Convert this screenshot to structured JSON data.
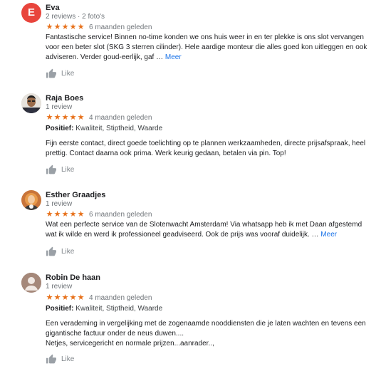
{
  "colors": {
    "star": "#e7711b",
    "link": "#1a73e8",
    "avatar_eva": "#e8453c"
  },
  "reviews": [
    {
      "name": "Eva",
      "meta": "2 reviews · 2 foto's",
      "avatar_letter": "E",
      "stars": 5,
      "date": "6 maanden geleden",
      "text": "Fantastische service! Binnen no-time konden we ons huis weer in en ter plekke is ons slot vervangen voor een beter slot (SKG 3 sterren cilinder). Hele aardige monteur die alles goed kon uitleggen en ook adviseren. Verder goud-eerlijk, gaf …",
      "more": "Meer",
      "like": "Like"
    },
    {
      "name": "Raja Boes",
      "meta": "1 review",
      "avatar_icon": "person-photo-icon",
      "stars": 5,
      "date": "4 maanden geleden",
      "positive_label": "Positief:",
      "positive_value": "Kwaliteit, Stiptheid, Waarde",
      "text": "Fijn eerste contact, direct goede toelichting op te plannen werkzaamheden, directe prijsafspraak, heel prettig. Contact daarna ook prima. Werk keurig gedaan, betalen via pin. Top!",
      "like": "Like"
    },
    {
      "name": "Esther Graadjes",
      "meta": "1 review",
      "avatar_icon": "person-photo-icon",
      "stars": 5,
      "date": "6 maanden geleden",
      "text": "Wat een perfecte service van de Slotenwacht Amsterdam! Via whatsapp heb ik met Daan afgestemd wat ik wilde en werd ik professioneel geadviseerd. Ook de prijs was vooraf duidelijk. …",
      "more": "Meer",
      "like": "Like"
    },
    {
      "name": "Robin De haan",
      "meta": "1 review",
      "avatar_icon": "default-avatar-icon",
      "stars": 5,
      "date": "4 maanden geleden",
      "positive_label": "Positief:",
      "positive_value": "Kwaliteit, Stiptheid, Waarde",
      "text": "Een verademing in vergelijking met de zogenaamde nooddiensten die je laten wachten en tevens een gigantische factuur onder de neus duwen....",
      "text_line2": "Netjes, servicegericht en normale prijzen...aanrader..,",
      "like": "Like"
    }
  ]
}
